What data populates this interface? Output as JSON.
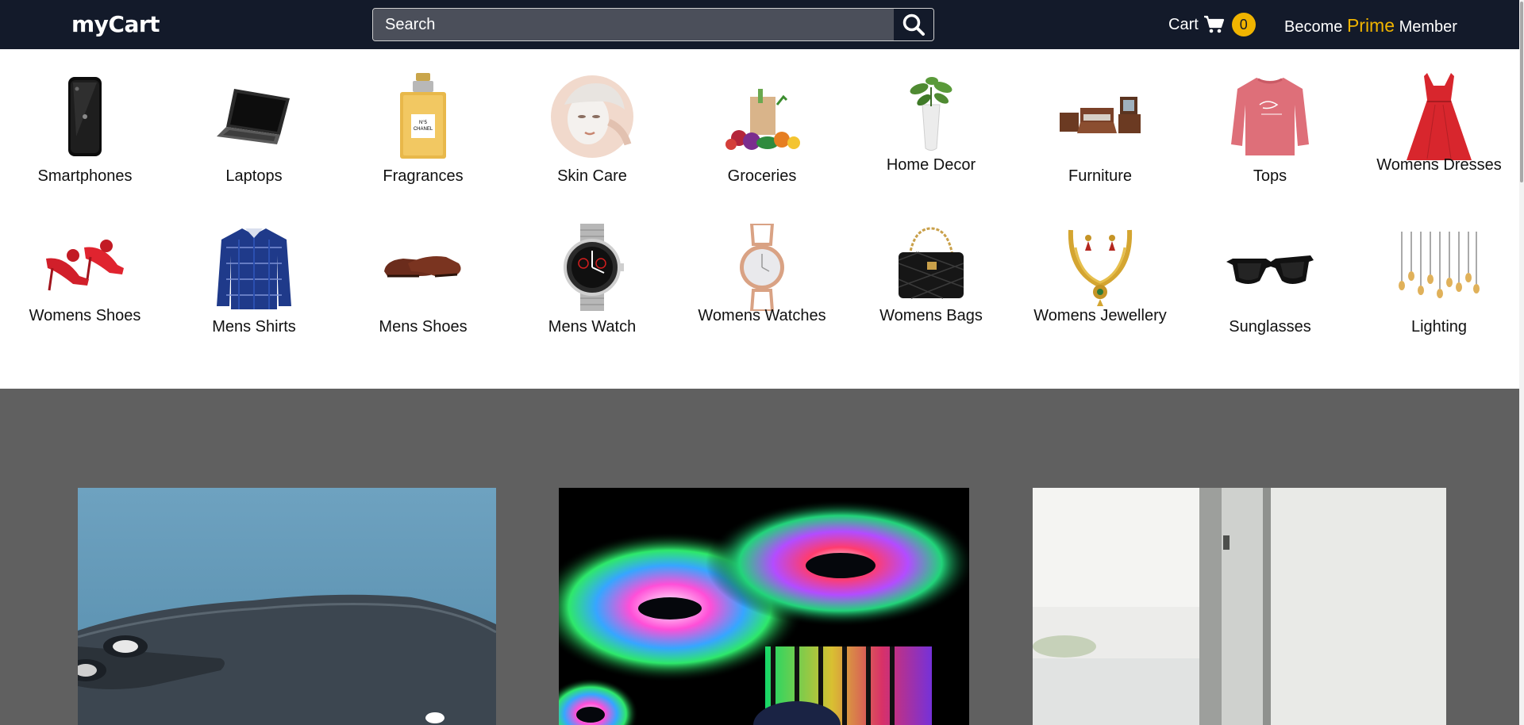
{
  "navbar": {
    "brand": "myCart",
    "search": {
      "placeholder": "Search",
      "value": ""
    },
    "cart": {
      "label": "Cart",
      "count": "0"
    },
    "prime": {
      "prefix": "Become",
      "highlight": "Prime",
      "suffix": "Member"
    }
  },
  "categories": [
    {
      "label": "Smartphones",
      "icon": "smartphone-icon"
    },
    {
      "label": "Laptops",
      "icon": "laptop-icon"
    },
    {
      "label": "Fragrances",
      "icon": "perfume-bottle-icon"
    },
    {
      "label": "Skin Care",
      "icon": "skin-care-icon"
    },
    {
      "label": "Groceries",
      "icon": "groceries-icon"
    },
    {
      "label": "Home Decor",
      "icon": "plant-vase-icon"
    },
    {
      "label": "Furniture",
      "icon": "furniture-icon"
    },
    {
      "label": "Tops",
      "icon": "sweater-icon"
    },
    {
      "label": "Womens Dresses",
      "icon": "dress-icon"
    },
    {
      "label": "Womens Shoes",
      "icon": "high-heels-icon"
    },
    {
      "label": "Mens Shirts",
      "icon": "shirt-icon"
    },
    {
      "label": "Mens Shoes",
      "icon": "mens-shoes-icon"
    },
    {
      "label": "Mens Watch",
      "icon": "mens-watch-icon"
    },
    {
      "label": "Womens Watches",
      "icon": "womens-watch-icon"
    },
    {
      "label": "Womens Bags",
      "icon": "handbag-icon"
    },
    {
      "label": "Womens Jewellery",
      "icon": "jewellery-icon"
    },
    {
      "label": "Sunglasses",
      "icon": "sunglasses-icon"
    },
    {
      "label": "Lighting",
      "icon": "pendant-lights-icon"
    }
  ],
  "banners": [
    {
      "icon": "phone-camera-image"
    },
    {
      "icon": "rgb-pc-fans-image"
    },
    {
      "icon": "window-interior-image"
    }
  ],
  "colors": {
    "navbar_bg": "#131a2a",
    "accent": "#f0b400",
    "page_bg": "#606060",
    "panel_bg": "#ffffff"
  }
}
